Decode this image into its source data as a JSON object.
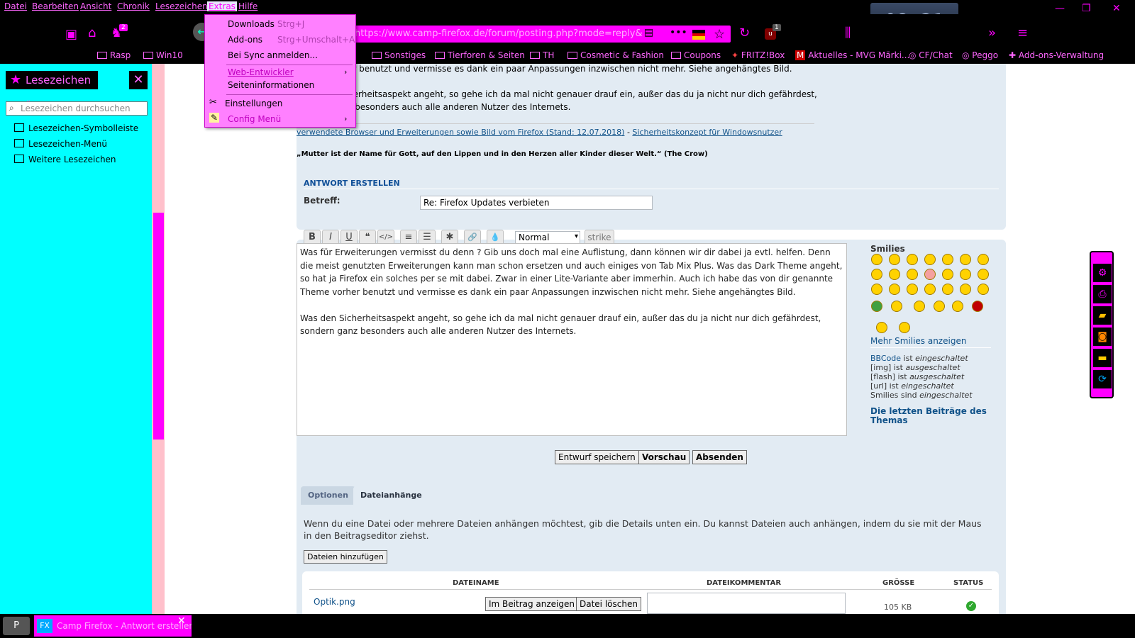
{
  "menubar": {
    "items": [
      "Datei",
      "Bearbeiten",
      "Ansicht",
      "Chronik",
      "Lesezeichen",
      "Extras",
      "Hilfe"
    ],
    "active": "Extras"
  },
  "clock": "08:21",
  "navbar": {
    "url": "https://www.camp-firefox.de/forum/posting.php?mode=reply&",
    "badge_addon": "2",
    "badge_ublock": "1",
    "icons": [
      "new-window-icon",
      "home-icon",
      "addon-icon",
      "back-icon",
      "reader-icon",
      "more-icon",
      "flag-de-icon",
      "star-icon",
      "reload-icon",
      "ublock-icon",
      "library-icon",
      "overflow-icon",
      "hamburger-icon"
    ]
  },
  "bookmarks": [
    {
      "label": "Rasp"
    },
    {
      "label": "Win10"
    },
    {
      "label": "Sonstiges"
    },
    {
      "label": "Tierforen & Seiten"
    },
    {
      "label": "TH"
    },
    {
      "label": "Cosmetic & Fashion"
    },
    {
      "label": "Coupons"
    },
    {
      "label": "FRITZ!Box"
    },
    {
      "label": "Aktuelles - MVG Märki..."
    },
    {
      "label": "CF/Chat"
    },
    {
      "label": "Peggo"
    },
    {
      "label": "Add-ons-Verwaltung"
    }
  ],
  "sidebar": {
    "title": "Lesezeichen",
    "search_placeholder": "Lesezeichen durchsuchen",
    "items": [
      "Lesezeichen-Symbolleiste",
      "Lesezeichen-Menü",
      "Weitere Lesezeichen"
    ]
  },
  "extras_menu": {
    "items": [
      {
        "label": "Downloads",
        "accel": "Strg+J"
      },
      {
        "label": "Add-ons",
        "accel": "Strg+Umschalt+A"
      },
      {
        "label": "Bei Sync anmelden..."
      },
      {
        "label": "Web-Entwickler"
      },
      {
        "label": "Seiteninformationen"
      },
      {
        "label": "Einstellungen"
      },
      {
        "label": "Config Menü"
      }
    ]
  },
  "post_preview": {
    "line1_tail": "er benutzt und vermisse es dank ein paar Anpassungen inzwischen nicht mehr. Siehe angehängtes Bild.",
    "line2_tail": "herheitsaspekt angeht, so gehe ich da mal nicht genauer drauf ein, außer das du ja nicht nur dich gefährdest,",
    "line3_tail": "z besonders auch alle anderen Nutzer des Internets.",
    "sig_link1": "verwendete Browser und Erweiterungen sowie Bild vom Firefox (Stand: 12.07.2018)",
    "sig_sep": " - ",
    "sig_link2": "Sicherheitskonzept für Windowsnutzer",
    "quote": "„Mutter ist der Name für Gott, auf den Lippen und in den Herzen aller Kinder dieser Welt.“ (The Crow)"
  },
  "reply": {
    "section_title": "ANTWORT ERSTELLEN",
    "subject_label": "Betreff:",
    "subject_value": "Re: Firefox Updates verbieten",
    "font_size_value": "Normal",
    "strike_label": "strike",
    "toolbar": [
      "B",
      "I",
      "U",
      "❝",
      "</>",
      "≡",
      "☰",
      "✱",
      "🔗",
      "💧"
    ],
    "editor_text": "Was für Erweiterungen vermisst du denn ? Gib uns doch mal eine Auflistung, dann können wir dir dabei ja evtl. helfen. Denn die meist genutzten Erweiterungen kann man schon ersetzen und auch einiges von Tab Mix Plus. Was das Dark Theme angeht, so hat ja Firefox ein solches per se mit dabei. Zwar in einer Lite-Variante aber immerhin. Auch ich habe das von dir genannte Theme vorher benutzt und vermisse es dank ein paar Anpassungen inzwischen nicht mehr. Siehe angehängtes Bild.\n\nWas den Sicherheitsaspekt angeht, so gehe ich da mal nicht genauer drauf ein, außer das du ja nicht nur dich gefährdest, sondern ganz besonders auch alle anderen Nutzer des Internets.",
    "smilies_title": "Smilies",
    "more_smilies": "Mehr Smilies anzeigen",
    "bbcode_line": [
      "BBCode",
      " ist ",
      "eingeschaltet"
    ],
    "img_line": [
      "[img] ist ",
      "ausgeschaltet"
    ],
    "flash_line": [
      "[flash] ist ",
      "ausgeschaltet"
    ],
    "url_line": [
      "[url] ist ",
      "eingeschaltet"
    ],
    "smilies_line": [
      "Smilies sind ",
      "eingeschaltet"
    ],
    "last_posts": "Die letzten Beiträge des Themas",
    "btn_draft": "Entwurf speichern",
    "btn_preview": "Vorschau",
    "btn_submit": "Absenden"
  },
  "attachments": {
    "tab_options": "Optionen",
    "tab_attachments": "Dateianhänge",
    "info": "Wenn du eine Datei oder mehrere Dateien anhängen möchtest, gib die Details unten ein. Du kannst Dateien auch anhängen, indem du sie mit der Maus in den Beitragseditor ziehst.",
    "add_button": "Dateien hinzufügen",
    "columns": [
      "DATEINAME",
      "DATEIKOMMENTAR",
      "GRÖSSE",
      "STATUS"
    ],
    "rows": [
      {
        "filename": "Optik.png",
        "show_btn": "Im Beitrag anzeigen",
        "delete_btn": "Datei löschen",
        "size": "105 KB"
      }
    ]
  },
  "taskbar": {
    "app_label": "Camp Firefox - Antwort erstellen"
  },
  "colors": {
    "accent": "#ff00ff",
    "sidebar_bg": "#00ffff",
    "chrome_bg": "#000000",
    "panel_bg": "#e2ebf3",
    "link": "#105289"
  }
}
